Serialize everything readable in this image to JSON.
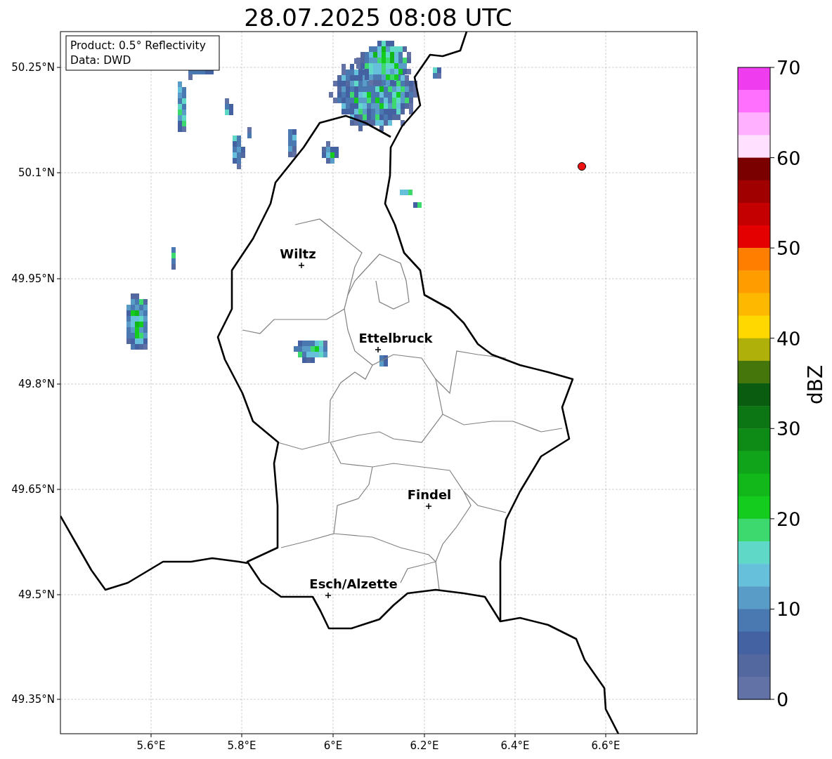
{
  "title": "28.07.2025 08:08 UTC",
  "info_box": {
    "lines": [
      "Product: 0.5° Reflectivity",
      "Data: DWD"
    ]
  },
  "map": {
    "y_ticks": [
      "50.25°N",
      "50.1°N",
      "49.95°N",
      "49.8°N",
      "49.65°N",
      "49.5°N",
      "49.35°N"
    ],
    "x_ticks": [
      "5.6°E",
      "5.8°E",
      "6°E",
      "6.2°E",
      "6.4°E",
      "6.6°E"
    ],
    "cities": [
      {
        "name": "Wiltz"
      },
      {
        "name": "Ettelbruck"
      },
      {
        "name": "Findel"
      },
      {
        "name": "Esch/Alzette"
      }
    ]
  },
  "colorbar": {
    "label": "dBZ",
    "ticks": [
      "70",
      "60",
      "50",
      "40",
      "30",
      "20",
      "10",
      "0"
    ],
    "bins": [
      {
        "color": "#ee3cee"
      },
      {
        "color": "#ff70ff"
      },
      {
        "color": "#ffb0ff"
      },
      {
        "color": "#ffe0ff"
      },
      {
        "color": "#7a0000"
      },
      {
        "color": "#a00000"
      },
      {
        "color": "#c40000"
      },
      {
        "color": "#e40000"
      },
      {
        "color": "#ff7e00"
      },
      {
        "color": "#ff9c00"
      },
      {
        "color": "#ffb800"
      },
      {
        "color": "#ffd800"
      },
      {
        "color": "#b0b00a"
      },
      {
        "color": "#44760c"
      },
      {
        "color": "#0a5c10"
      },
      {
        "color": "#0c7614"
      },
      {
        "color": "#0e8a16"
      },
      {
        "color": "#10a41a"
      },
      {
        "color": "#12b81a"
      },
      {
        "color": "#14cc1e"
      },
      {
        "color": "#3dd86e"
      },
      {
        "color": "#60d8c8"
      },
      {
        "color": "#66c0dc"
      },
      {
        "color": "#5a9cc8"
      },
      {
        "color": "#4a78b0"
      },
      {
        "color": "#4462a2"
      },
      {
        "color": "#53689e"
      },
      {
        "color": "#6372a6"
      }
    ]
  }
}
